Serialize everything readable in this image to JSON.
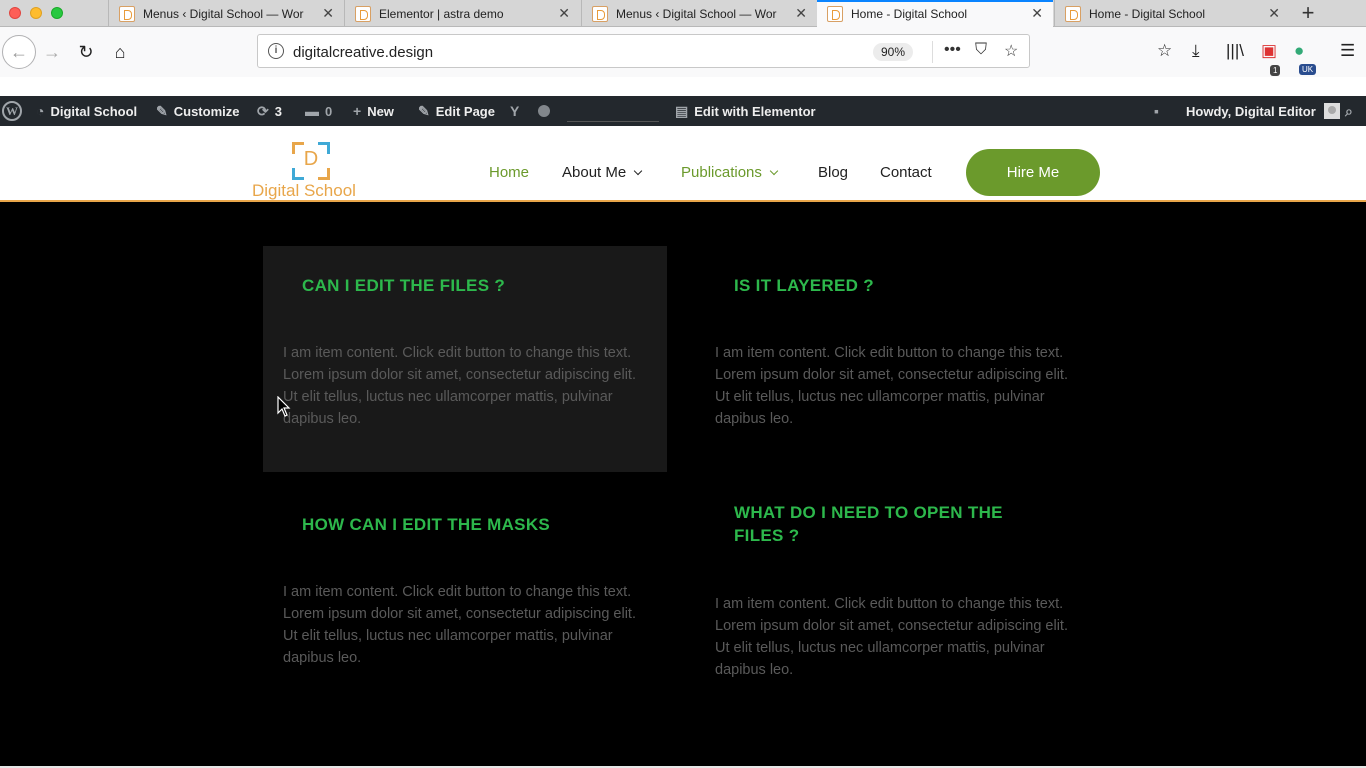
{
  "browser": {
    "tabs": [
      {
        "title": "Menus ‹ Digital School — Wor",
        "active": false
      },
      {
        "title": "Elementor | astra demo",
        "active": false
      },
      {
        "title": "Menus ‹ Digital School — Wor",
        "active": false
      },
      {
        "title": "Home - Digital School",
        "active": true
      },
      {
        "title": "Home - Digital School",
        "active": false
      }
    ],
    "url": "digitalcreative.design",
    "zoom": "90%",
    "extension_badge": "1",
    "locale_badge": "UK"
  },
  "adminbar": {
    "site_name": "Digital School",
    "customize": "Customize",
    "updates_count": "3",
    "comments_count": "0",
    "new_label": "New",
    "edit_page": "Edit Page",
    "edit_elementor": "Edit with Elementor",
    "howdy": "Howdy, Digital Editor"
  },
  "header": {
    "logo_letter": "D",
    "logo_text": "Digital School",
    "menu": [
      "Home",
      "About Me",
      "Publications",
      "Blog",
      "Contact"
    ],
    "cta": "Hire Me",
    "accent": "#6b9a2c",
    "logo_color": "#e8a64a"
  },
  "faq": [
    {
      "question": "CAN I EDIT THE FILES ?",
      "answer": "I am item content. Click edit button to change this text. Lorem ipsum dolor sit amet, consectetur adipiscing elit. Ut elit tellus, luctus nec ullamcorper mattis, pulvinar dapibus leo."
    },
    {
      "question": "IS IT LAYERED ?",
      "answer": "I am item content. Click edit button to change this text. Lorem ipsum dolor sit amet, consectetur adipiscing elit. Ut elit tellus, luctus nec ullamcorper mattis, pulvinar dapibus leo."
    },
    {
      "question": "HOW CAN I EDIT THE MASKS",
      "answer": "I am item content. Click edit button to change this text. Lorem ipsum dolor sit amet, consectetur adipiscing elit. Ut elit tellus, luctus nec ullamcorper mattis, pulvinar dapibus leo."
    },
    {
      "question": "WHAT DO I NEED TO OPEN THE FILES ?",
      "answer": "I am item content. Click edit button to change this text. Lorem ipsum dolor sit amet, consectetur adipiscing elit. Ut elit tellus, luctus nec ullamcorper mattis, pulvinar dapibus leo."
    }
  ],
  "faq_heading_color": "#2db84c"
}
